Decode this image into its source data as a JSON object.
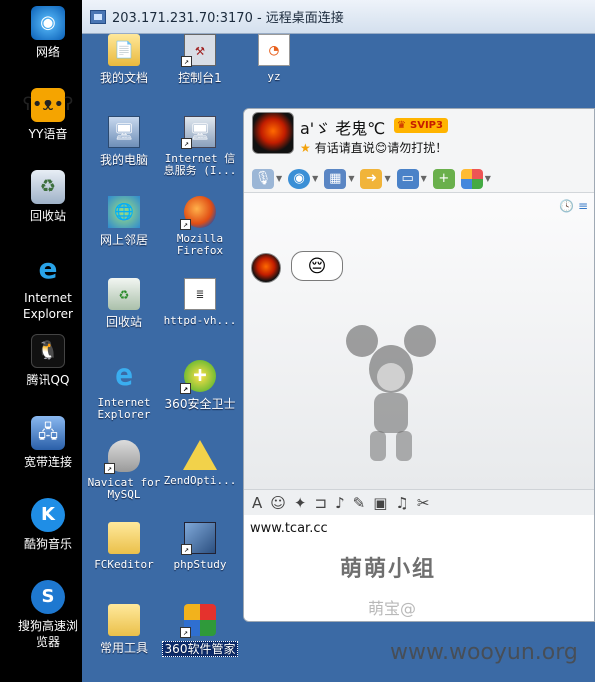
{
  "local_desktop": {
    "icons": [
      {
        "label": "网络",
        "icon": "network-globe-icon"
      },
      {
        "label": "YY语音",
        "icon": "yy-bear-icon"
      },
      {
        "label": "回收站",
        "icon": "recycle-bin-icon"
      },
      {
        "label": "Internet\nExplorer",
        "icon": "ie-icon"
      },
      {
        "label": "腾讯QQ",
        "icon": "qq-penguin-icon"
      },
      {
        "label": "宽带连接",
        "icon": "broadband-connection-icon"
      },
      {
        "label": "酷狗音乐",
        "icon": "kugou-icon"
      },
      {
        "label": "搜狗高速浏\n览器",
        "icon": "sogou-browser-icon"
      }
    ]
  },
  "rdp_window": {
    "title": "203.171.231.70:3170 - 远程桌面连接"
  },
  "remote_desktop": {
    "icons": [
      {
        "label": "我的文档",
        "icon": "my-documents-folder-icon",
        "font": "cn"
      },
      {
        "label": "控制台1",
        "icon": "console-icon",
        "font": "cn"
      },
      {
        "label": "yz",
        "icon": "firefox-file-icon",
        "font": "mono"
      },
      {
        "label": "我的电脑",
        "icon": "my-computer-icon",
        "font": "cn"
      },
      {
        "label": "Internet 信\n息服务 (I...",
        "icon": "iis-icon",
        "font": "mono"
      },
      {
        "label": "网上邻居",
        "icon": "network-places-icon",
        "font": "cn"
      },
      {
        "label": "Mozilla\nFirefox",
        "icon": "firefox-icon",
        "font": "mono"
      },
      {
        "label": "回收站",
        "icon": "recycle-bin-icon",
        "font": "cn"
      },
      {
        "label": "httpd-vh...",
        "icon": "text-file-icon",
        "font": "mono"
      },
      {
        "label": "Internet\nExplorer",
        "icon": "ie-icon",
        "font": "mono"
      },
      {
        "label": "360安全卫士",
        "icon": "360-safe-icon",
        "font": "cn"
      },
      {
        "label": "Navicat for\nMySQL",
        "icon": "navicat-icon",
        "font": "mono"
      },
      {
        "label": "ZendOpti...",
        "icon": "zend-icon",
        "font": "mono"
      },
      {
        "label": "FCKeditor",
        "icon": "folder-icon",
        "font": "mono"
      },
      {
        "label": "phpStudy",
        "icon": "phpstudy-icon",
        "font": "mono"
      },
      {
        "label": "常用工具",
        "icon": "folder-icon",
        "font": "cn"
      },
      {
        "label": "360软件管家",
        "icon": "360-software-icon",
        "font": "cn",
        "selected": true
      }
    ]
  },
  "chat": {
    "name": "a'ゞ  老鬼℃",
    "badge": "SVIP3",
    "signature_prefix": "有话请直说",
    "signature_suffix": "请勿打扰！",
    "history_clock_glyph": "🕓 ≡",
    "message_emoji": "😔",
    "input_text": "www.tcar.cc",
    "toolbar_icons": [
      "microphone-icon",
      "video-camera-icon",
      "screen-share-icon",
      "file-transfer-icon",
      "remote-desktop-icon",
      "add-app-icon",
      "apps-grid-icon"
    ],
    "input_toolbar_icons": [
      "font-icon",
      "emoji-icon",
      "shake-icon",
      "screenshot-icon",
      "voice-message-icon",
      "edit-icon",
      "image-icon",
      "music-icon",
      "scissors-icon"
    ]
  },
  "watermarks": {
    "group": "萌萌小组",
    "group_sub": "萌宝@",
    "site": "www.wooyun.org"
  },
  "colors": {
    "remote_background": "#3b6aa5",
    "local_background": "#000000",
    "svip_badge": "#ffb400",
    "accent_blue": "#3578c8"
  }
}
